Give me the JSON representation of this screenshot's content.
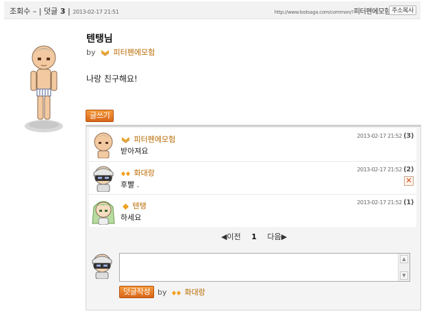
{
  "header": {
    "views_label": "조회수 –",
    "comments_label": "| 덧글",
    "comment_count": "3",
    "date": "2013-02-17 21:51",
    "url_text": "http://www.lostsaga.com/common/?",
    "url_author": "피터펜에모험",
    "copy_button": "주소복사"
  },
  "post": {
    "title": "텐탱님",
    "by_label": "by",
    "author": "피터펜에모험",
    "body": "나랑 친구해요!",
    "write_button": "글쓰기"
  },
  "comments": [
    {
      "author": "피터펜에모험",
      "text": "받아져요",
      "date": "2013-02-17 21:52",
      "number": "(3)",
      "deletable": false
    },
    {
      "author": "화대랑",
      "text": "후빨 .",
      "date": "2013-02-17 21:52",
      "number": "(2)",
      "deletable": true
    },
    {
      "author": "텐탱",
      "text": "하세요",
      "date": "2013-02-17 21:52",
      "number": "(1)",
      "deletable": false
    }
  ],
  "pager": {
    "prev": "◀이전",
    "current": "1",
    "next": "다음▶"
  },
  "reply": {
    "submit_button": "덧글작성",
    "by_label": "by",
    "author": "화대랑",
    "delete_symbol": "✕"
  },
  "colors": {
    "accent": "#e07a28",
    "username": "#b86a00",
    "panel": "#f4f4f4"
  },
  "icons": [
    "rank-chevron-icon",
    "rank-diamond-icon",
    "delete-icon",
    "scroll-up-icon",
    "scroll-down-icon"
  ]
}
